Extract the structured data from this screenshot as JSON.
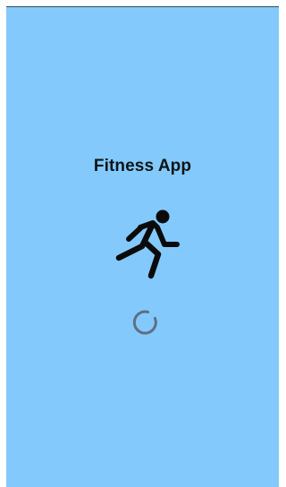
{
  "app": {
    "title": "Fitness App",
    "icon": "running-person-icon",
    "loading_indicator": "loading-spinner-icon"
  },
  "colors": {
    "background": "#83c9fc",
    "text": "#0f1418",
    "icon": "#0b0b0b",
    "spinner": "#5f6f84"
  }
}
